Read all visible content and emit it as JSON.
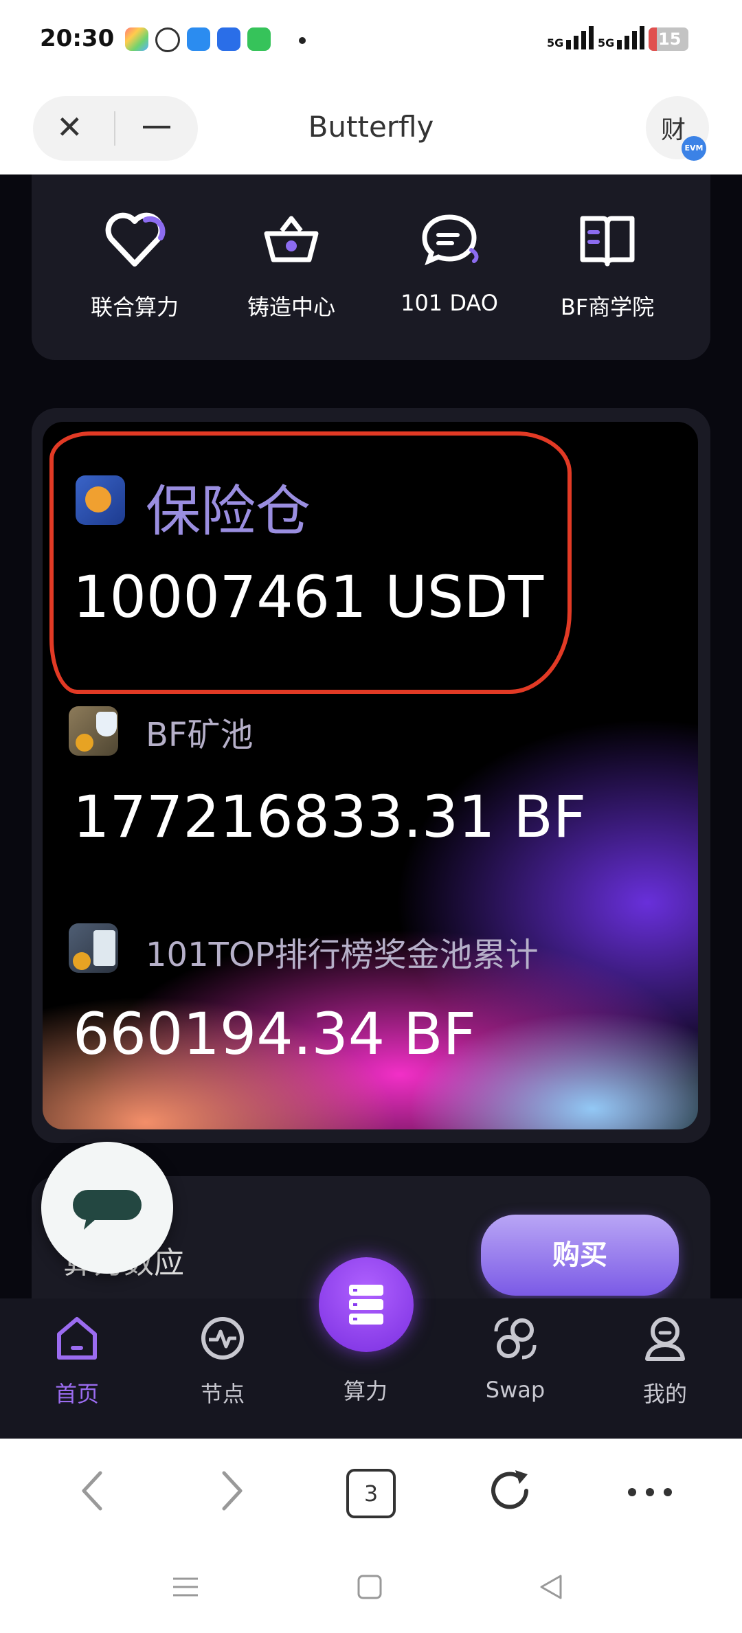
{
  "status_bar": {
    "time": "20:30",
    "network_1": "5G",
    "network_2": "5G",
    "battery": "15"
  },
  "browser": {
    "title": "Butterfly",
    "close_icon": "close-icon",
    "minimize_icon": "minimize-icon",
    "mini_program_label": "财",
    "badge_label": "EVM"
  },
  "menu": {
    "items": [
      {
        "label": "联合算力",
        "icon": "heart-icon"
      },
      {
        "label": "铸造中心",
        "icon": "basket-icon"
      },
      {
        "label": "101 DAO",
        "icon": "chat-icon"
      },
      {
        "label": "BF商学院",
        "icon": "book-icon"
      }
    ]
  },
  "stats": [
    {
      "label": "保险仓",
      "value": "10007461 USDT",
      "icon": "safe-icon"
    },
    {
      "label": "BF矿池",
      "value": "177216833.31 BF",
      "icon": "money-bag-icon"
    },
    {
      "label": "101TOP排行榜奖金池累计",
      "value": "660194.34 BF",
      "icon": "chart-coins-icon"
    }
  ],
  "lower_card": {
    "label": "算力数应",
    "buy_label": "购买"
  },
  "bottom_nav": {
    "items": [
      {
        "label": "首页",
        "icon": "home-icon",
        "active": true
      },
      {
        "label": "节点",
        "icon": "pulse-icon",
        "active": false
      },
      {
        "label": "算力",
        "icon": "server-icon",
        "active": false
      },
      {
        "label": "Swap",
        "icon": "swap-icon",
        "active": false
      },
      {
        "label": "我的",
        "icon": "user-icon",
        "active": false
      }
    ]
  },
  "toolbar": {
    "tab_count": "3"
  },
  "colors": {
    "accent": "#9b6cf0",
    "highlight": "#e23a25",
    "background": "#08080f"
  }
}
